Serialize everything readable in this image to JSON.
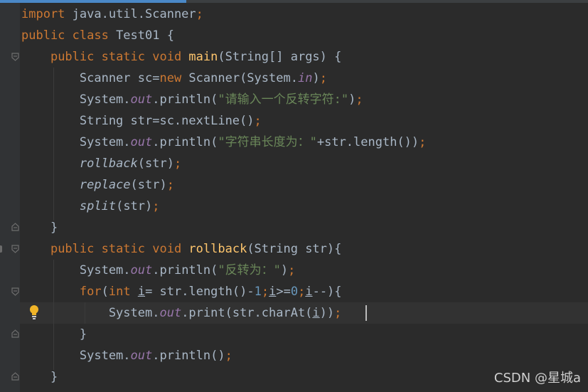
{
  "editor": {
    "lines": [
      {
        "parts": [
          [
            "kw",
            "import "
          ],
          [
            "",
            "java.util.Scanner"
          ],
          [
            "kw",
            ";"
          ]
        ]
      },
      {
        "parts": [
          [
            "kw",
            "public class "
          ],
          [
            "",
            "Test01 {"
          ]
        ]
      },
      {
        "parts": [
          [
            "",
            "    "
          ],
          [
            "kw",
            "public static void "
          ],
          [
            "fn",
            "main"
          ],
          [
            "",
            "(String[] args) {"
          ]
        ]
      },
      {
        "parts": [
          [
            "",
            "        Scanner sc="
          ],
          [
            "kw",
            "new "
          ],
          [
            "",
            "Scanner(System."
          ],
          [
            "fld",
            "in"
          ],
          [
            "",
            ")"
          ],
          [
            "kw",
            ";"
          ]
        ]
      },
      {
        "parts": [
          [
            "",
            "        System."
          ],
          [
            "fld",
            "out"
          ],
          [
            "",
            ".println("
          ],
          [
            "str",
            "\"请输入一个反转字符:\""
          ],
          [
            "",
            ")"
          ],
          [
            "kw",
            ";"
          ]
        ]
      },
      {
        "parts": [
          [
            "",
            "        String str=sc.nextLine()"
          ],
          [
            "kw",
            ";"
          ]
        ]
      },
      {
        "parts": [
          [
            "",
            "        System."
          ],
          [
            "fld",
            "out"
          ],
          [
            "",
            ".println("
          ],
          [
            "str",
            "\"字符串长度为：\""
          ],
          [
            "",
            "+str.length())"
          ],
          [
            "kw",
            ";"
          ]
        ]
      },
      {
        "parts": [
          [
            "",
            "        "
          ],
          [
            "ital",
            "rollback"
          ],
          [
            "",
            "(str)"
          ],
          [
            "kw",
            ";"
          ]
        ]
      },
      {
        "parts": [
          [
            "",
            "        "
          ],
          [
            "ital",
            "replace"
          ],
          [
            "",
            "(str)"
          ],
          [
            "kw",
            ";"
          ]
        ]
      },
      {
        "parts": [
          [
            "",
            "        "
          ],
          [
            "ital",
            "split"
          ],
          [
            "",
            "(str)"
          ],
          [
            "kw",
            ";"
          ]
        ]
      },
      {
        "parts": [
          [
            "",
            "    }"
          ]
        ]
      },
      {
        "parts": [
          [
            "",
            "    "
          ],
          [
            "kw",
            "public static void "
          ],
          [
            "fn",
            "rollback"
          ],
          [
            "",
            "(String str){"
          ]
        ]
      },
      {
        "parts": [
          [
            "",
            "        System."
          ],
          [
            "fld",
            "out"
          ],
          [
            "",
            ".println("
          ],
          [
            "str",
            "\"反转为：\""
          ],
          [
            "",
            ")"
          ],
          [
            "kw",
            ";"
          ]
        ]
      },
      {
        "parts": [
          [
            "",
            "        "
          ],
          [
            "kw",
            "for"
          ],
          [
            "",
            "("
          ],
          [
            "kw",
            "int "
          ],
          [
            "und",
            "i"
          ],
          [
            "",
            "= str.length()-"
          ],
          [
            "num",
            "1"
          ],
          [
            "kw",
            ";"
          ],
          [
            "und",
            "i"
          ],
          [
            "",
            ">="
          ],
          [
            "num",
            "0"
          ],
          [
            "kw",
            ";"
          ],
          [
            "und",
            "i"
          ],
          [
            "",
            "--){"
          ]
        ]
      },
      {
        "parts": [
          [
            "",
            "            System."
          ],
          [
            "fld",
            "out"
          ],
          [
            "",
            ".print(str.charAt("
          ],
          [
            "und",
            "i"
          ],
          [
            "",
            "))"
          ],
          [
            "kw",
            ";"
          ]
        ]
      },
      {
        "parts": [
          [
            "",
            "        }"
          ]
        ]
      },
      {
        "parts": [
          [
            "",
            "        System."
          ],
          [
            "fld",
            "out"
          ],
          [
            "",
            ".println()"
          ],
          [
            "kw",
            ";"
          ]
        ]
      },
      {
        "parts": [
          [
            "",
            "    }"
          ]
        ]
      }
    ]
  },
  "watermark": "CSDN @星城a",
  "colors": {
    "background": "#2b2b2b",
    "keyword": "#cc7832",
    "method_decl": "#ffc66d",
    "string": "#6a8759",
    "number": "#6897bb",
    "static_field": "#9876aa",
    "text": "#a9b7c6"
  },
  "icons": {
    "gutter": [
      "fold-icon",
      "override-icon"
    ],
    "intention": "lightbulb-icon"
  }
}
